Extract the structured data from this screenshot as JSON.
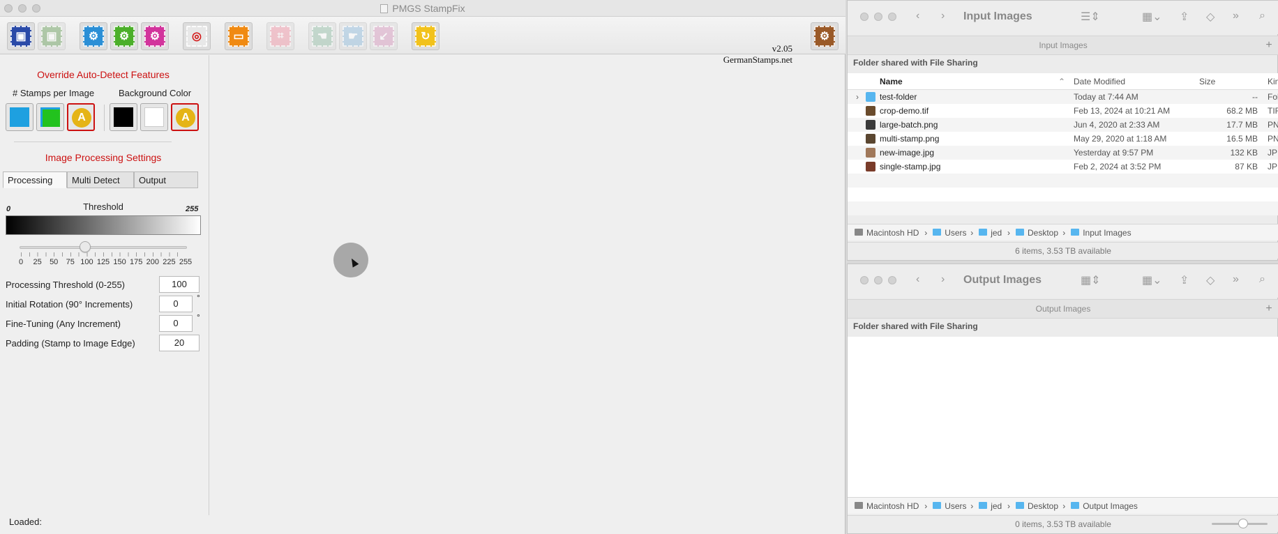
{
  "app": {
    "title": "PMGS StampFix",
    "version": "v2.05",
    "site": "GermanStamps.net",
    "toolbar_icons": [
      {
        "name": "save-icon",
        "color": "#2a4aa8",
        "glyph": "▣"
      },
      {
        "name": "save-disabled-icon",
        "color": "#7aa86e",
        "glyph": "▣"
      },
      {
        "name": "settings-blue-icon",
        "color": "#2b8fd6",
        "glyph": "⚙"
      },
      {
        "name": "settings-green-icon",
        "color": "#4caf2a",
        "glyph": "⚙"
      },
      {
        "name": "settings-pink-icon",
        "color": "#d2349c",
        "glyph": "⚙"
      },
      {
        "name": "target-icon",
        "color": "#e8e8e8",
        "glyph": "◎"
      },
      {
        "name": "display-icon",
        "color": "#f08a12",
        "glyph": "▭"
      },
      {
        "name": "crop-icon",
        "color": "#ef9fae",
        "glyph": "⌗"
      },
      {
        "name": "hand-pointer-icon",
        "color": "#9fc4b0",
        "glyph": "☚"
      },
      {
        "name": "hand-click-icon",
        "color": "#9cc2de",
        "glyph": "☛"
      },
      {
        "name": "arrow-icon",
        "color": "#d9a3c4",
        "glyph": "↙"
      },
      {
        "name": "refresh-icon",
        "color": "#f2c21b",
        "glyph": "↻"
      },
      {
        "name": "gear-icon",
        "color": "#9a5a28",
        "glyph": "⚙"
      }
    ],
    "override_heading": "Override Auto-Detect Features",
    "stamps_label": "# Stamps per Image",
    "background_label": "Background Color",
    "auto_glyph": "A",
    "processing_heading": "Image Processing Settings",
    "tabs": [
      "Processing",
      "Multi Detect",
      "Output"
    ],
    "threshold_label": "Threshold",
    "threshold_min": "0",
    "threshold_max": "255",
    "threshold_value": 100,
    "tick_labels": [
      "0",
      "25",
      "50",
      "75",
      "100",
      "125",
      "150",
      "175",
      "200",
      "225",
      "255"
    ],
    "fields": [
      {
        "label": "Processing Threshold (0-255)",
        "value": "100",
        "unit": ""
      },
      {
        "label": "Initial Rotation (90° Increments)",
        "value": "0",
        "unit": "°"
      },
      {
        "label": "Fine-Tuning (Any Increment)",
        "value": "0",
        "unit": "°"
      },
      {
        "label": "Padding (Stamp to Image Edge)",
        "value": "20",
        "unit": ""
      }
    ],
    "status": "Loaded:"
  },
  "finder_input": {
    "title": "Input Images",
    "tab_label": "Input Images",
    "shared_label": "Folder shared with File Sharing",
    "columns": {
      "name": "Name",
      "date": "Date Modified",
      "size": "Size",
      "kind": "Kin"
    },
    "rows": [
      {
        "name": "test-folder",
        "date": "Today at 7:44 AM",
        "size": "--",
        "kind": "Fol",
        "folder": true
      },
      {
        "name": "crop-demo.tif",
        "date": "Feb 13, 2024 at 10:21 AM",
        "size": "68.2 MB",
        "kind": "TIF",
        "folder": false
      },
      {
        "name": "large-batch.png",
        "date": "Jun 4, 2020 at 2:33 AM",
        "size": "17.7 MB",
        "kind": "PN",
        "folder": false
      },
      {
        "name": "multi-stamp.png",
        "date": "May 29, 2020 at 1:18 AM",
        "size": "16.5 MB",
        "kind": "PN",
        "folder": false
      },
      {
        "name": "new-image.jpg",
        "date": "Yesterday at 9:57 PM",
        "size": "132 KB",
        "kind": "JP",
        "folder": false
      },
      {
        "name": "single-stamp.jpg",
        "date": "Feb 2, 2024 at 3:52 PM",
        "size": "87 KB",
        "kind": "JP",
        "folder": false
      }
    ],
    "path": [
      "Macintosh HD",
      "Users",
      "jed",
      "Desktop",
      "Input Images"
    ],
    "status": "6 items, 3.53 TB available"
  },
  "finder_output": {
    "title": "Output Images",
    "tab_label": "Output Images",
    "shared_label": "Folder shared with File Sharing",
    "path": [
      "Macintosh HD",
      "Users",
      "jed",
      "Desktop",
      "Output Images"
    ],
    "status": "0 items, 3.53 TB available"
  }
}
